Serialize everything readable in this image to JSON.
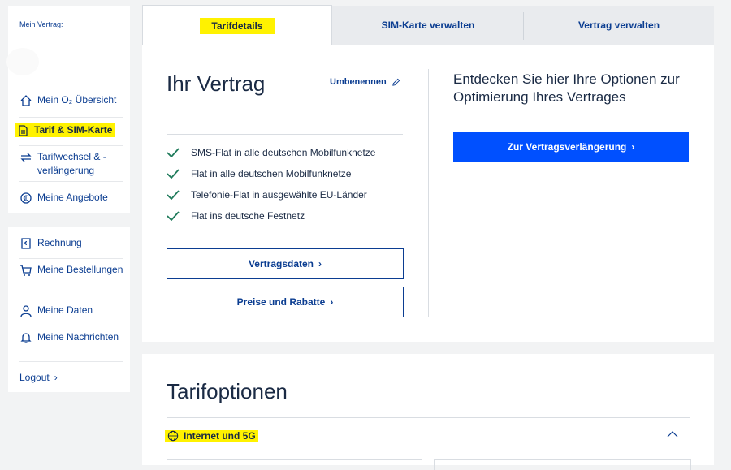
{
  "sidebar": {
    "vertrag_label": "Mein Vertrag:",
    "top_items": [
      {
        "label": "Mein O₂ Übersicht",
        "icon": "home-icon"
      },
      {
        "label": "Tarif & SIM-Karte",
        "icon": "sim-card-icon"
      },
      {
        "label": "Tarifwechsel & -verlängerung",
        "icon": "swap-arrows-icon"
      },
      {
        "label": "Meine Angebote",
        "icon": "offer-tag-icon"
      }
    ],
    "bottom_items": [
      {
        "label": "Rechnung",
        "icon": "invoice-icon"
      },
      {
        "label": "Meine Bestellungen",
        "icon": "shopping-cart-icon"
      },
      {
        "label": "Meine Daten",
        "icon": "user-icon"
      },
      {
        "label": "Meine Nachrichten",
        "icon": "bell-icon"
      }
    ],
    "logout_label": "Logout"
  },
  "tabs": [
    {
      "label": "Tarifdetails",
      "active": true
    },
    {
      "label": "SIM-Karte verwalten",
      "active": false
    },
    {
      "label": "Vertrag verwalten",
      "active": false
    }
  ],
  "contract": {
    "title": "Ihr Vertrag",
    "rename_label": "Umbenennen",
    "features": [
      "SMS-Flat in alle deutschen Mobilfunknetze",
      "Flat in alle deutschen Mobilfunknetze",
      "Telefonie-Flat in ausgewählte EU-Länder",
      "Flat ins deutsche Festnetz"
    ],
    "btn_vertragsdaten": "Vertragsdaten",
    "btn_preise": "Preise und Rabatte"
  },
  "discover": {
    "text": "Entdecken Sie hier Ihre Optionen zur Optimierung Ihres Vertrages",
    "cta": "Zur Vertragsverlängerung"
  },
  "tarifoptionen": {
    "title": "Tarifoptionen",
    "accordion_label": "Internet und 5G"
  },
  "colors": {
    "primary": "#0050ff",
    "link": "#0b3d91",
    "highlight": "#fff200",
    "check": "#1e7a5a"
  }
}
